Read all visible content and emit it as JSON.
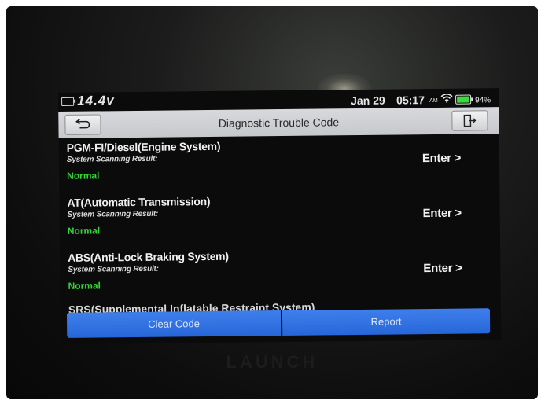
{
  "status_bar": {
    "voltage": "14.4v",
    "date": "Jan 29",
    "time": "05:17",
    "ampm": "AM",
    "battery_percent": "94%",
    "battery_level": 0.94
  },
  "title_bar": {
    "title": "Diagnostic Trouble Code",
    "back_icon": "back-arrow-icon",
    "exit_icon": "exit-icon"
  },
  "systems": [
    {
      "name": "PGM-FI/Diesel(Engine System)",
      "result_label": "System Scanning Result:",
      "status": "Normal",
      "action": "Enter >"
    },
    {
      "name": "AT(Automatic Transmission)",
      "result_label": "System Scanning Result:",
      "status": "Normal",
      "action": "Enter >"
    },
    {
      "name": "ABS(Anti-Lock Braking System)",
      "result_label": "System Scanning Result:",
      "status": "Normal",
      "action": "Enter >"
    }
  ],
  "partial_system": "SRS(Supplemental Inflatable Restraint System)",
  "bottom_bar": {
    "clear_code": "Clear Code",
    "report": "Report"
  },
  "brand": "LAUNCH",
  "colors": {
    "status_ok": "#36d636",
    "button_blue": "#2f6fe0",
    "title_bar": "#cfd1d4"
  }
}
